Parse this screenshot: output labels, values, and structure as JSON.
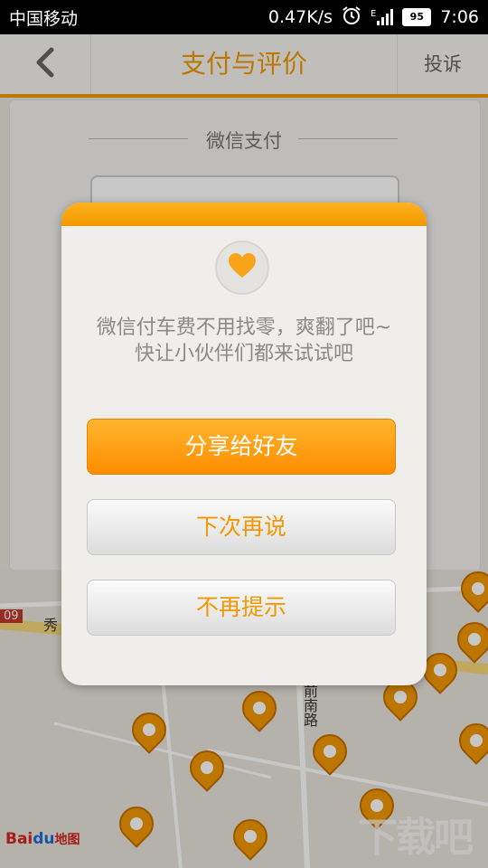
{
  "status_bar": {
    "carrier": "中国移动",
    "speed": "0.47K/s",
    "network": "E",
    "battery": "95",
    "time": "7:06"
  },
  "header": {
    "title": "支付与评价",
    "complaint": "投诉"
  },
  "payment": {
    "method_label": "微信支付"
  },
  "dialog": {
    "message": "微信付车费不用找零，爽翻了吧~ 快让小伙伴们都来试试吧",
    "share_button": "分享给好友",
    "later_button": "下次再说",
    "never_button": "不再提示"
  },
  "map": {
    "road_label": "前南路",
    "road_label2": "秀",
    "road_number": "09",
    "logo_text_bai": "Bai",
    "logo_text_du": "du",
    "logo_text_map": "地图"
  },
  "watermark": "下载吧",
  "colors": {
    "accent": "#f39800",
    "share_button": "#ff8c00"
  }
}
